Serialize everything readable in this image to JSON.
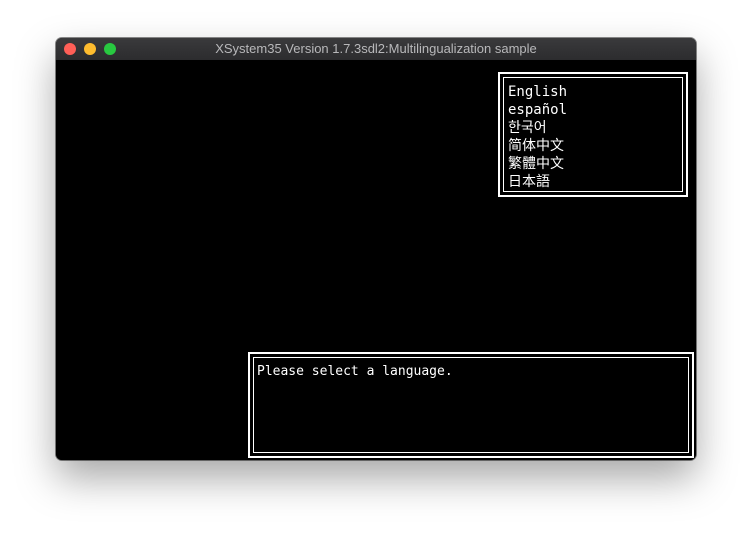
{
  "window": {
    "title": "XSystem35 Version 1.7.3sdl2:Multilingualization sample"
  },
  "language_menu": {
    "items": [
      {
        "label": "English"
      },
      {
        "label": "español"
      },
      {
        "label": "한국어"
      },
      {
        "label": "简体中文"
      },
      {
        "label": "繁體中文"
      },
      {
        "label": "日本語"
      }
    ]
  },
  "message_box": {
    "text": "Please select a language."
  },
  "colors": {
    "background": "#000000",
    "text": "#ffffff",
    "titlebar": "#2c2c2e",
    "close_button": "#ff5f57",
    "minimize_button": "#febc2e",
    "maximize_button": "#28c840"
  }
}
